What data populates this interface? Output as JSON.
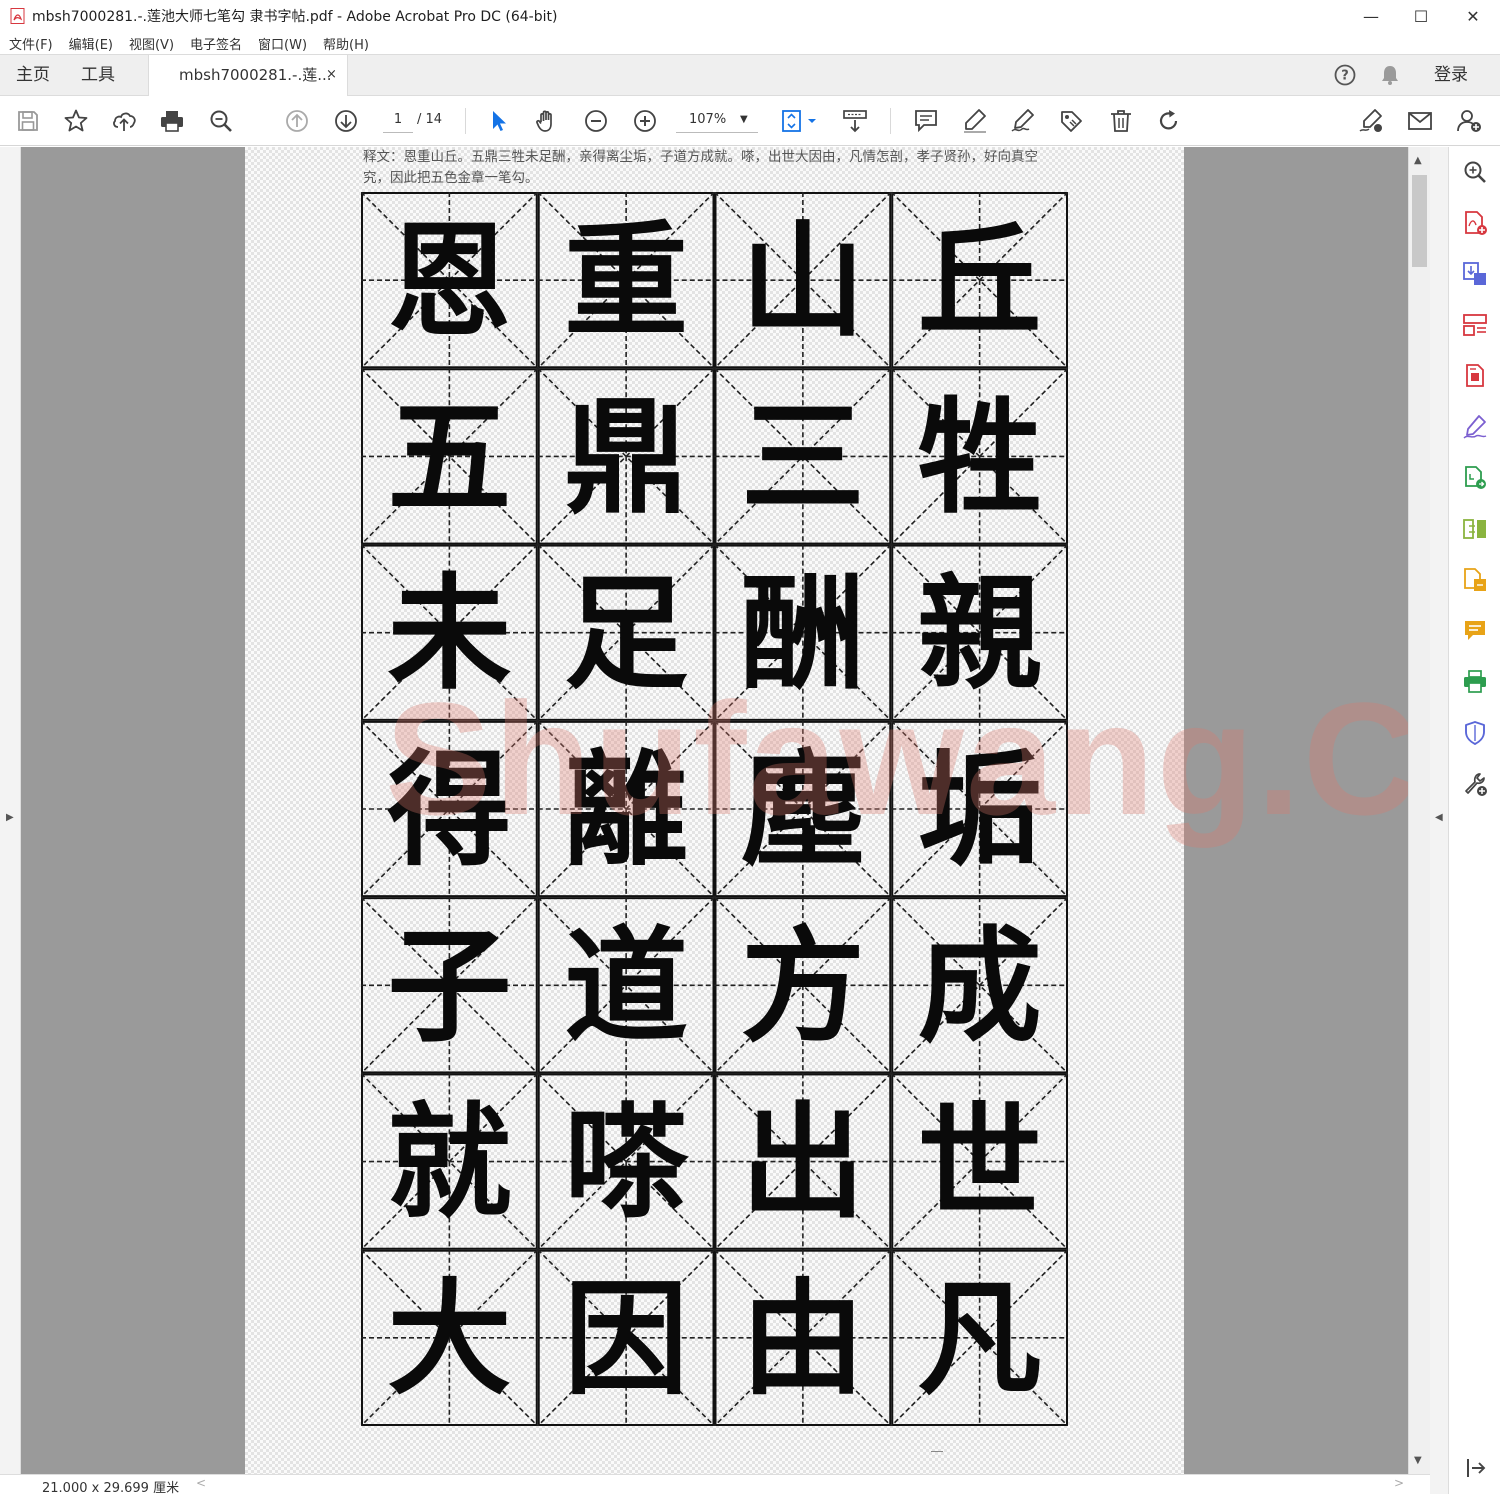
{
  "window": {
    "title": "mbsh7000281.-.莲池大师七笔勾 隶书字帖.pdf - Adobe Acrobat Pro DC (64-bit)",
    "minimize": "—",
    "maximize": "☐",
    "close": "✕"
  },
  "menu": [
    "文件(F)",
    "编辑(E)",
    "视图(V)",
    "电子签名",
    "窗口(W)",
    "帮助(H)"
  ],
  "tabs": {
    "home": "主页",
    "tools": "工具",
    "document": "mbsh7000281.-.莲...",
    "close": "×",
    "login": "登录"
  },
  "toolbar": {
    "page_current": "1",
    "page_total": "/ 14",
    "zoom": "107%"
  },
  "document": {
    "caption": "释文：恩重山丘。五鼎三牲未足酬，亲得离尘垢，子道方成就。嗏，出世大因由，凡情怎剖，孝子贤孙，好向真空究，因此把五色金章一笔勾。",
    "grid_rows": [
      [
        "恩",
        "重",
        "山",
        "丘"
      ],
      [
        "五",
        "鼎",
        "三",
        "牲"
      ],
      [
        "未",
        "足",
        "酬",
        "親"
      ],
      [
        "得",
        "離",
        "塵",
        "垢"
      ],
      [
        "子",
        "道",
        "方",
        "成"
      ],
      [
        "就",
        "嗏",
        "出",
        "世"
      ],
      [
        "大",
        "因",
        "由",
        "凡"
      ]
    ],
    "watermark": "Shufawang.CN",
    "page_marker": "—"
  },
  "statusbar": {
    "dimensions": "21.000 x 29.699 厘米"
  },
  "colors": {
    "accent_blue": "#1473e6",
    "pdf_red": "#d7373f",
    "purple": "#7b5fd0",
    "green": "#2d9d4f",
    "orange": "#e8a317"
  }
}
